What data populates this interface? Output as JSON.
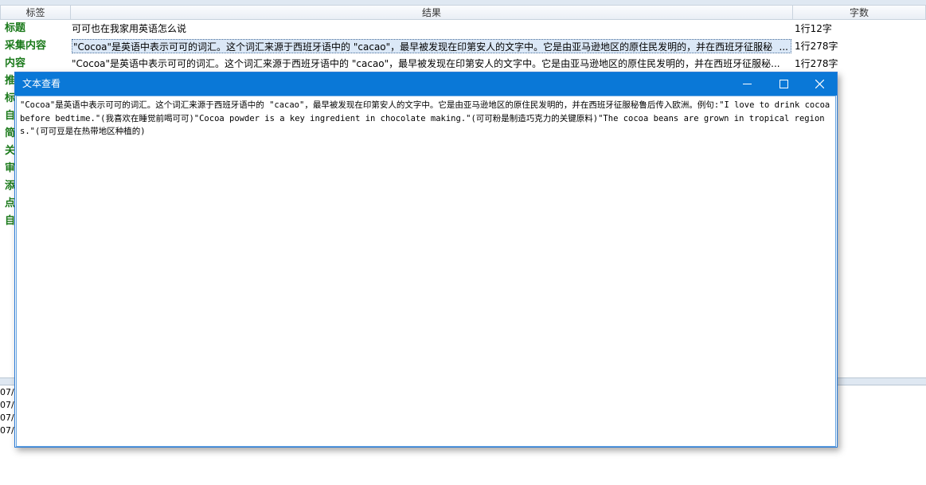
{
  "grid": {
    "headers": {
      "label": "标签",
      "result": "结果",
      "count": "字数"
    },
    "rows": [
      {
        "label": "标题",
        "result": "可可也在我家用英语怎么说",
        "count": "1行12字"
      },
      {
        "label": "采集内容",
        "result": "\"Cocoa\"是英语中表示可可的词汇。这个词汇来源于西班牙语中的 \"cacao\"，最早被发现在印第安人的文字中。它是由亚马逊地区的原住民发明的，并在西班牙征服秘",
        "count": "1行278字"
      },
      {
        "label": "内容",
        "result": "\"Cocoa\"是英语中表示可可的词汇。这个词汇来源于西班牙语中的 \"cacao\"，最早被发现在印第安人的文字中。它是由亚马逊地区的原住民发明的，并在西班牙征服秘...",
        "count": "1行278字"
      },
      {
        "label": "推",
        "result": "",
        "count": ""
      },
      {
        "label": "标",
        "result": "",
        "count": ""
      },
      {
        "label": "自",
        "result": "",
        "count": ""
      },
      {
        "label": "简",
        "result": "",
        "count": ""
      },
      {
        "label": "关",
        "result": "",
        "count": ""
      },
      {
        "label": "审",
        "result": "",
        "count": ""
      },
      {
        "label": "添",
        "result": "",
        "count": ""
      },
      {
        "label": "点",
        "result": "",
        "count": ""
      },
      {
        "label": "自",
        "result": "",
        "count": ""
      }
    ],
    "ellipsis": "..."
  },
  "log": {
    "lines": [
      "07/",
      "07/",
      "07/",
      "07/"
    ]
  },
  "dialog": {
    "title": "文本查看",
    "text": "\"Cocoa\"是英语中表示可可的词汇。这个词汇来源于西班牙语中的 \"cacao\"，最早被发现在印第安人的文字中。它是由亚马逊地区的原住民发明的，并在西班牙征服秘鲁后传入欧洲。例句:\"I love to drink cocoa before bedtime.\"(我喜欢在睡觉前喝可可)\"Cocoa powder is a key ingredient in chocolate making.\"(可可粉是制造巧克力的关键原料)\"The cocoa beans are grown in tropical regions.\"(可可豆是在热带地区种植的)"
  },
  "colors": {
    "titlebar": "#0a78d7",
    "label_green": "#1b7a1b",
    "selection": "#dbe8f7"
  }
}
